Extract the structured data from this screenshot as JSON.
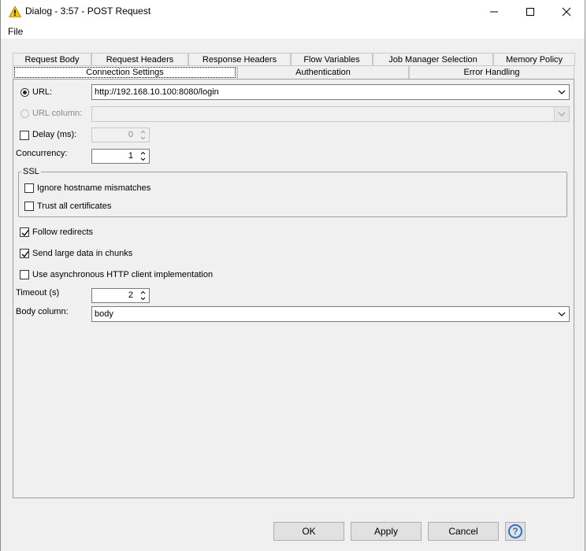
{
  "window": {
    "title": "Dialog - 3:57 - POST Request",
    "accent_warning": "#f2c200"
  },
  "menu": {
    "file": "File"
  },
  "tabs": {
    "row1": [
      "Request Body",
      "Request Headers",
      "Response Headers",
      "Flow Variables",
      "Job Manager Selection",
      "Memory Policy"
    ],
    "row2": [
      "Connection Settings",
      "Authentication",
      "Error Handling"
    ],
    "active": "Connection Settings"
  },
  "form": {
    "url_label": "URL:",
    "url_value": "http://192.168.10.100:8080/login",
    "url_column_label": "URL column:",
    "url_column_value": "",
    "delay_label": "Delay (ms):",
    "delay_value": "0",
    "concurrency_label": "Concurrency:",
    "concurrency_value": "1",
    "ssl_legend": "SSL",
    "ignore_hostname_label": "Ignore hostname mismatches",
    "trust_all_label": "Trust all certificates",
    "follow_redirects_label": "Follow redirects",
    "send_chunks_label": "Send large data in chunks",
    "async_label": "Use asynchronous HTTP client implementation",
    "timeout_label": "Timeout (s)",
    "timeout_value": "2",
    "body_column_label": "Body column:",
    "body_column_value": "body"
  },
  "buttons": {
    "ok": "OK",
    "apply": "Apply",
    "cancel": "Cancel",
    "help": "?"
  }
}
